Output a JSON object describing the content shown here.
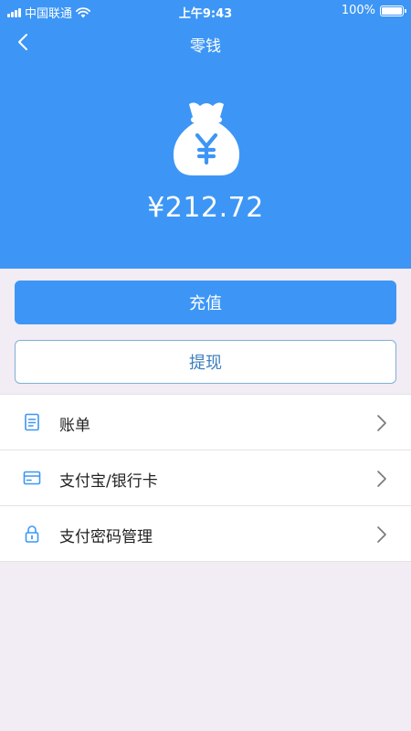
{
  "status_bar": {
    "carrier": "中国联通",
    "time": "上午9:43",
    "battery": "100%"
  },
  "nav": {
    "title": "零钱",
    "back_icon": "chevron-left-icon"
  },
  "wallet": {
    "icon": "money-bag-yuan-icon",
    "balance": "¥212.72"
  },
  "actions": {
    "recharge_label": "充值",
    "withdraw_label": "提现"
  },
  "menu": {
    "items": [
      {
        "label": "账单",
        "icon": "bill-icon"
      },
      {
        "label": "支付宝/银行卡",
        "icon": "card-icon"
      },
      {
        "label": "支付密码管理",
        "icon": "lock-icon"
      }
    ]
  },
  "colors": {
    "primary": "#3d96f5",
    "background": "#f2ecf4",
    "outline_text": "#3d7fbf"
  }
}
